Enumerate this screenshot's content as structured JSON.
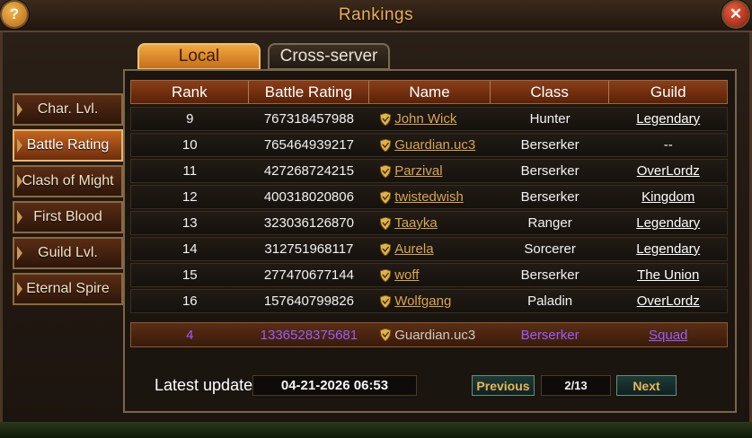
{
  "window": {
    "title": "Rankings",
    "help_glyph": "?",
    "close_glyph": "✕"
  },
  "tabs": [
    {
      "label": "Local",
      "active": true
    },
    {
      "label": "Cross-server",
      "active": false
    }
  ],
  "sidebar": {
    "items": [
      {
        "label": "Char. Lvl."
      },
      {
        "label": "Battle Rating"
      },
      {
        "label": "Clash of Might"
      },
      {
        "label": "First Blood"
      },
      {
        "label": "Guild Lvl."
      },
      {
        "label": "Eternal Spire"
      }
    ],
    "active": "Battle Rating"
  },
  "table": {
    "headers": [
      "Rank",
      "Battle Rating",
      "Name",
      "Class",
      "Guild"
    ],
    "rows": [
      {
        "rank": "9",
        "rating": "767318457988",
        "name": "John Wick",
        "class": "Hunter",
        "guild": "Legendary"
      },
      {
        "rank": "10",
        "rating": "765464939217",
        "name": "Guardian.uc3",
        "class": "Berserker",
        "guild": "--"
      },
      {
        "rank": "11",
        "rating": "427268724215",
        "name": "Parzival",
        "class": "Berserker",
        "guild": "OverLordz"
      },
      {
        "rank": "12",
        "rating": "400318020806",
        "name": "twistedwish",
        "class": "Berserker",
        "guild": "Kingdom"
      },
      {
        "rank": "13",
        "rating": "323036126870",
        "name": "Taayka",
        "class": "Ranger",
        "guild": "Legendary"
      },
      {
        "rank": "14",
        "rating": "312751968117",
        "name": "Aurela",
        "class": "Sorcerer",
        "guild": "Legendary"
      },
      {
        "rank": "15",
        "rating": "277470677144",
        "name": "woff",
        "class": "Berserker",
        "guild": "The Union"
      },
      {
        "rank": "16",
        "rating": "157640799826",
        "name": "Wolfgang",
        "class": "Paladin",
        "guild": "OverLordz"
      }
    ],
    "self_row": {
      "rank": "4",
      "rating": "1336528375681",
      "name": "Guardian.uc3",
      "class": "Berserker",
      "guild": "Squad"
    }
  },
  "footer": {
    "latest_update_label": "Latest update",
    "latest_update_value": "04-21-2026 06:53",
    "previous_label": "Previous",
    "page": "2/13",
    "next_label": "Next"
  },
  "colors": {
    "accent": "#f0b04a",
    "self_row_text": "#9a5aff",
    "name_link": "#d9a54c"
  },
  "icons": {
    "rank_shield": "shield-icon"
  }
}
